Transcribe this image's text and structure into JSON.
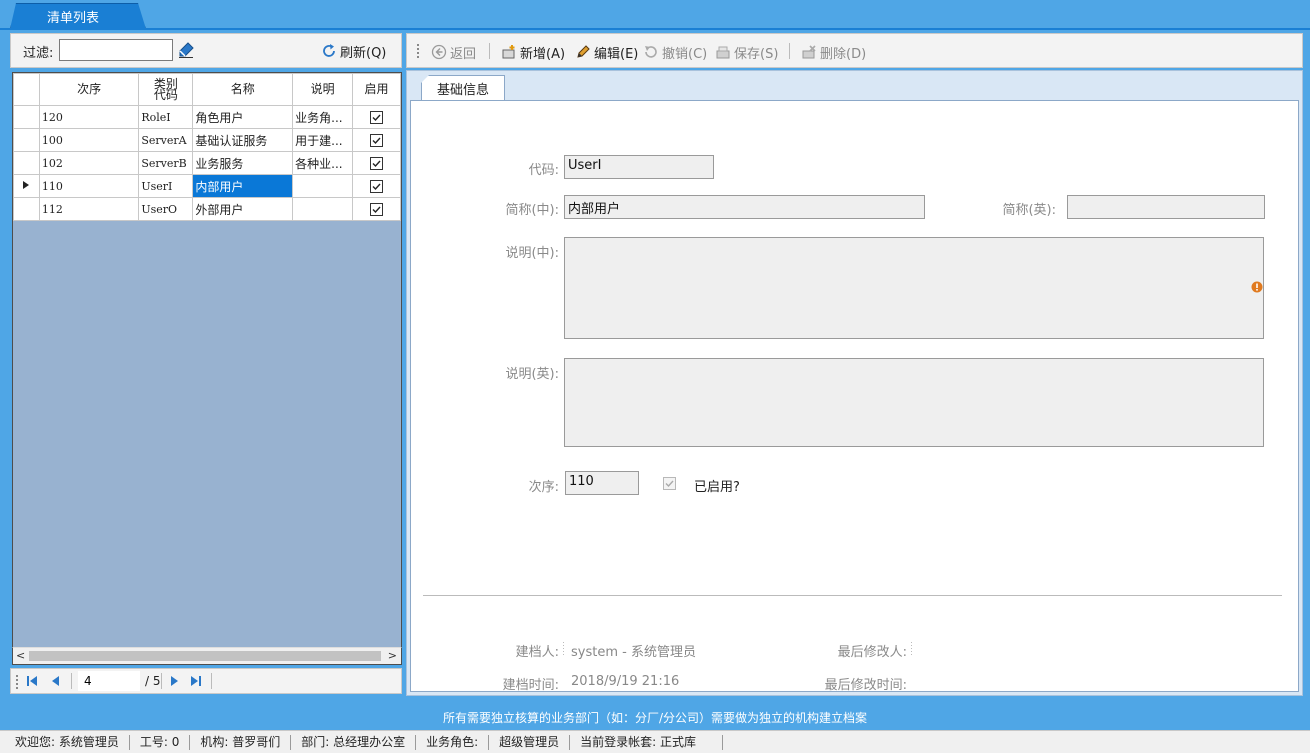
{
  "top_tab": {
    "label": "清单列表"
  },
  "filter": {
    "label": "过滤:",
    "value": "",
    "placeholder": ""
  },
  "refresh_label": "刷新(Q)",
  "grid": {
    "headers": [
      "次序",
      "类别\n代码",
      "名称",
      "说明",
      "启用"
    ],
    "rows": [
      {
        "order": "120",
        "code": "RoleI",
        "name": "角色用户",
        "desc": "业务角...",
        "enabled": true,
        "current": false
      },
      {
        "order": "100",
        "code": "ServerA",
        "name": "基础认证服务",
        "desc": "用于建...",
        "enabled": true,
        "current": false
      },
      {
        "order": "102",
        "code": "ServerB",
        "name": "业务服务",
        "desc": "各种业...",
        "enabled": true,
        "current": false
      },
      {
        "order": "110",
        "code": "UserI",
        "name": "内部用户",
        "desc": "",
        "enabled": true,
        "current": true
      },
      {
        "order": "112",
        "code": "UserO",
        "name": "外部用户",
        "desc": "",
        "enabled": true,
        "current": false
      }
    ]
  },
  "pager": {
    "current": "4",
    "total": "/ 5"
  },
  "toolbar": {
    "back": "返回",
    "add": "新增(A)",
    "edit": "编辑(E)",
    "undo": "撤销(C)",
    "save": "保存(S)",
    "delete": "删除(D)"
  },
  "form": {
    "tab": "基础信息",
    "code_label": "代码:",
    "code_value": "UserI",
    "name_cn_label": "简称(中):",
    "name_cn_value": "内部用户",
    "name_en_label": "简称(英):",
    "name_en_value": "",
    "desc_cn_label": "说明(中):",
    "desc_cn_value": "",
    "desc_en_label": "说明(英):",
    "desc_en_value": "",
    "order_label": "次序:",
    "order_value": "110",
    "enabled_label": "已启用?",
    "enabled": true
  },
  "audit": {
    "creator_label": "建档人:",
    "creator_value": "system - 系统管理员",
    "modifier_label": "最后修改人:",
    "modifier_value": "",
    "created_label": "建档时间:",
    "created_value": "2018/9/19 21:16",
    "modified_label": "最后修改时间:",
    "modified_value": ""
  },
  "info_text": "所有需要独立核算的业务部门（如：分厂/分公司）需要做为独立的机构建立档案",
  "status": {
    "welcome": "欢迎您: 系统管理员",
    "job_no": "工号: 0",
    "org": "机构: 普罗哥们",
    "dept": "部门: 总经理办公室",
    "role_label": "业务角色:",
    "role": "超级管理员",
    "account": "当前登录帐套: 正式库"
  },
  "colors": {
    "background": "#4fa6e6",
    "accent": "#1a7fd4",
    "selection": "#0a78d7",
    "grid_empty": "#98b2d0",
    "warning": "#e07a1f"
  }
}
